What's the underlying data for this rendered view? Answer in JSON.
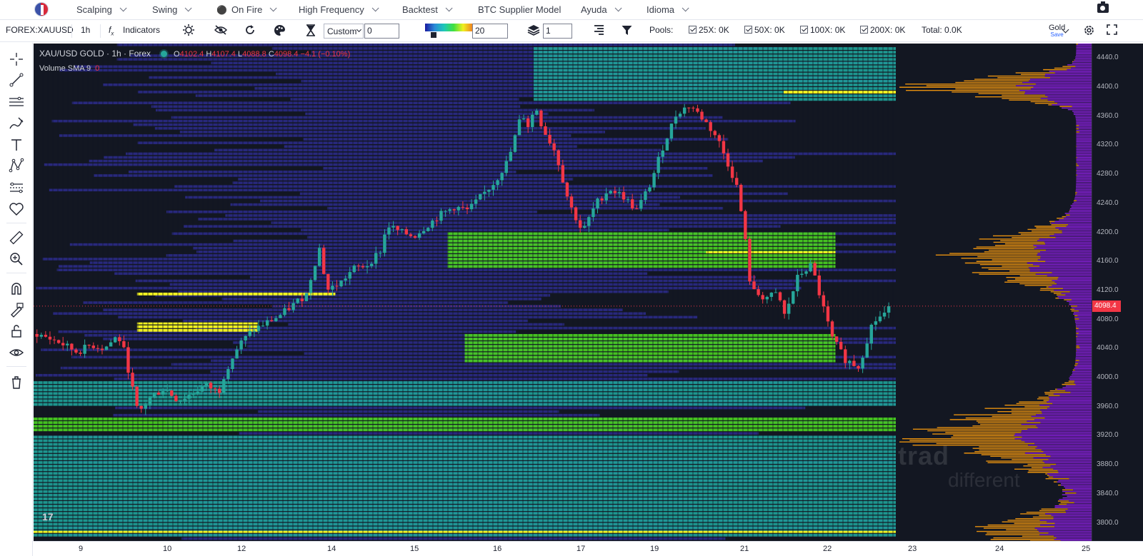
{
  "topnav": {
    "items": [
      {
        "label": "Scalping",
        "dropdown": true
      },
      {
        "label": "Swing",
        "dropdown": true
      },
      {
        "label": "On Fire",
        "dropdown": true,
        "icon": "fire-icon"
      },
      {
        "label": "High Frequency",
        "dropdown": true
      },
      {
        "label": "Backtest",
        "dropdown": true
      },
      {
        "label": "BTC Supplier Model",
        "dropdown": false
      },
      {
        "label": "Ayuda",
        "dropdown": true
      },
      {
        "label": "Idioma",
        "dropdown": true
      }
    ]
  },
  "toolbar": {
    "symbol": "FOREX:XAUUSD",
    "interval": "1h",
    "indicators_label": "Indicators",
    "preset_select": "Custom",
    "preset_value": "0",
    "gradient_value": "20",
    "layers_value": "1",
    "pools_label": "Pools:",
    "pools": [
      {
        "label": "25X: 0K",
        "checked": true
      },
      {
        "label": "50X: 0K",
        "checked": true
      },
      {
        "label": "100X: 0K",
        "checked": true
      },
      {
        "label": "200X: 0K",
        "checked": true
      }
    ],
    "total_label": "Total: 0.0K",
    "layout_name": "Gold",
    "layout_save": "Save"
  },
  "legend": {
    "title": "XAU/USD GOLD · 1h · Forex",
    "open_label": "O",
    "open": "4102.4",
    "high_label": "H",
    "high": "4107.4",
    "low_label": "L",
    "low": "4088.8",
    "close_label": "C",
    "close": "4098.4",
    "change": "−4.1 (−0.10%)",
    "volume_label": "Volume SMA 9",
    "volume_value": "0"
  },
  "watermark": {
    "line1": "trad",
    "line2": "different"
  },
  "colors": {
    "up": "#26a69a",
    "down": "#f23645",
    "background": "#131722",
    "heat_low": "#2d2b8c",
    "heat_mid": "#1fa39a",
    "heat_high": "#4ad420",
    "heat_peak": "#f0f020",
    "profile_bid": "#e6900f",
    "profile_ask": "#8b1fe0"
  },
  "chart_data": {
    "type": "candlestick-heatmap",
    "symbol": "XAU/USD",
    "interval": "1h",
    "ylim": [
      3775,
      4460
    ],
    "y_ticks": [
      4440.0,
      4400.0,
      4360.0,
      4320.0,
      4280.0,
      4240.0,
      4200.0,
      4160.0,
      4120.0,
      4080.0,
      4040.0,
      4000.0,
      3960.0,
      3920.0,
      3880.0,
      3840.0,
      3800.0
    ],
    "y_tick_labels": [
      "4440.0",
      "4400.0",
      "4360.0",
      "4320.0",
      "4280.0",
      "4240.0",
      "4200.0",
      "4160.0",
      "4120.0",
      "4080.0",
      "4040.0",
      "4000.0",
      "3960.0",
      "3920.0",
      "3880.0",
      "3840.0",
      "3800.0"
    ],
    "current_price": 4098.4,
    "current_price_label": "4098.4",
    "x_ticks": [
      "9",
      "10",
      "12",
      "14",
      "15",
      "16",
      "17",
      "19",
      "21",
      "22",
      "23",
      "24",
      "25"
    ],
    "price_path": [
      [
        0,
        4060
      ],
      [
        3,
        4050
      ],
      [
        6,
        4035
      ],
      [
        8,
        4045
      ],
      [
        10,
        4040
      ],
      [
        12,
        4058
      ],
      [
        13,
        4035
      ],
      [
        15,
        3950
      ],
      [
        17,
        3975
      ],
      [
        19,
        3985
      ],
      [
        21,
        3968
      ],
      [
        23,
        3978
      ],
      [
        25,
        3990
      ],
      [
        27,
        3980
      ],
      [
        28,
        4010
      ],
      [
        30,
        4045
      ],
      [
        32,
        4065
      ],
      [
        34,
        4075
      ],
      [
        36,
        4085
      ],
      [
        38,
        4100
      ],
      [
        40,
        4115
      ],
      [
        41,
        4150
      ],
      [
        42,
        4180
      ],
      [
        43,
        4120
      ],
      [
        45,
        4130
      ],
      [
        47,
        4150
      ],
      [
        49,
        4155
      ],
      [
        51,
        4175
      ],
      [
        52,
        4210
      ],
      [
        54,
        4200
      ],
      [
        56,
        4195
      ],
      [
        58,
        4210
      ],
      [
        60,
        4225
      ],
      [
        62,
        4235
      ],
      [
        64,
        4230
      ],
      [
        66,
        4250
      ],
      [
        68,
        4270
      ],
      [
        70,
        4300
      ],
      [
        72,
        4365
      ],
      [
        73,
        4345
      ],
      [
        74,
        4375
      ],
      [
        75,
        4345
      ],
      [
        77,
        4310
      ],
      [
        79,
        4240
      ],
      [
        81,
        4200
      ],
      [
        83,
        4240
      ],
      [
        85,
        4260
      ],
      [
        87,
        4250
      ],
      [
        89,
        4230
      ],
      [
        91,
        4265
      ],
      [
        93,
        4320
      ],
      [
        95,
        4365
      ],
      [
        97,
        4375
      ],
      [
        99,
        4355
      ],
      [
        101,
        4330
      ],
      [
        103,
        4285
      ],
      [
        104,
        4260
      ],
      [
        105,
        4200
      ],
      [
        106,
        4120
      ],
      [
        108,
        4110
      ],
      [
        110,
        4115
      ],
      [
        111,
        4085
      ],
      [
        113,
        4140
      ],
      [
        115,
        4155
      ],
      [
        116,
        4120
      ],
      [
        118,
        4055
      ],
      [
        120,
        4025
      ],
      [
        122,
        4015
      ],
      [
        124,
        4075
      ],
      [
        126,
        4090
      ],
      [
        127,
        4098.4
      ]
    ],
    "heat_bands": [
      {
        "from": 4380,
        "to": 4455,
        "level": "mid",
        "x_start": 0.58,
        "x_end": 1.0
      },
      {
        "from": 4390,
        "to": 4395,
        "level": "peak",
        "x_start": 0.87,
        "x_end": 1.0
      },
      {
        "from": 4150,
        "to": 4200,
        "level": "high",
        "x_start": 0.48,
        "x_end": 0.93
      },
      {
        "from": 4170,
        "to": 4174,
        "level": "peak",
        "x_start": 0.78,
        "x_end": 0.93
      },
      {
        "from": 4112,
        "to": 4117,
        "level": "peak",
        "x_start": 0.12,
        "x_end": 0.35
      },
      {
        "from": 4062,
        "to": 4076,
        "level": "peak",
        "x_start": 0.12,
        "x_end": 0.26
      },
      {
        "from": 4020,
        "to": 4060,
        "level": "high",
        "x_start": 0.5,
        "x_end": 0.93
      },
      {
        "from": 3960,
        "to": 3995,
        "level": "mid",
        "x_start": 0.0,
        "x_end": 1.0
      },
      {
        "from": 3925,
        "to": 3945,
        "level": "high",
        "x_start": 0.0,
        "x_end": 1.0
      },
      {
        "from": 3780,
        "to": 3920,
        "level": "mid",
        "x_start": 0.0,
        "x_end": 1.0
      },
      {
        "from": 3785,
        "to": 3789,
        "level": "peak",
        "x_start": 0.0,
        "x_end": 1.0
      }
    ]
  }
}
